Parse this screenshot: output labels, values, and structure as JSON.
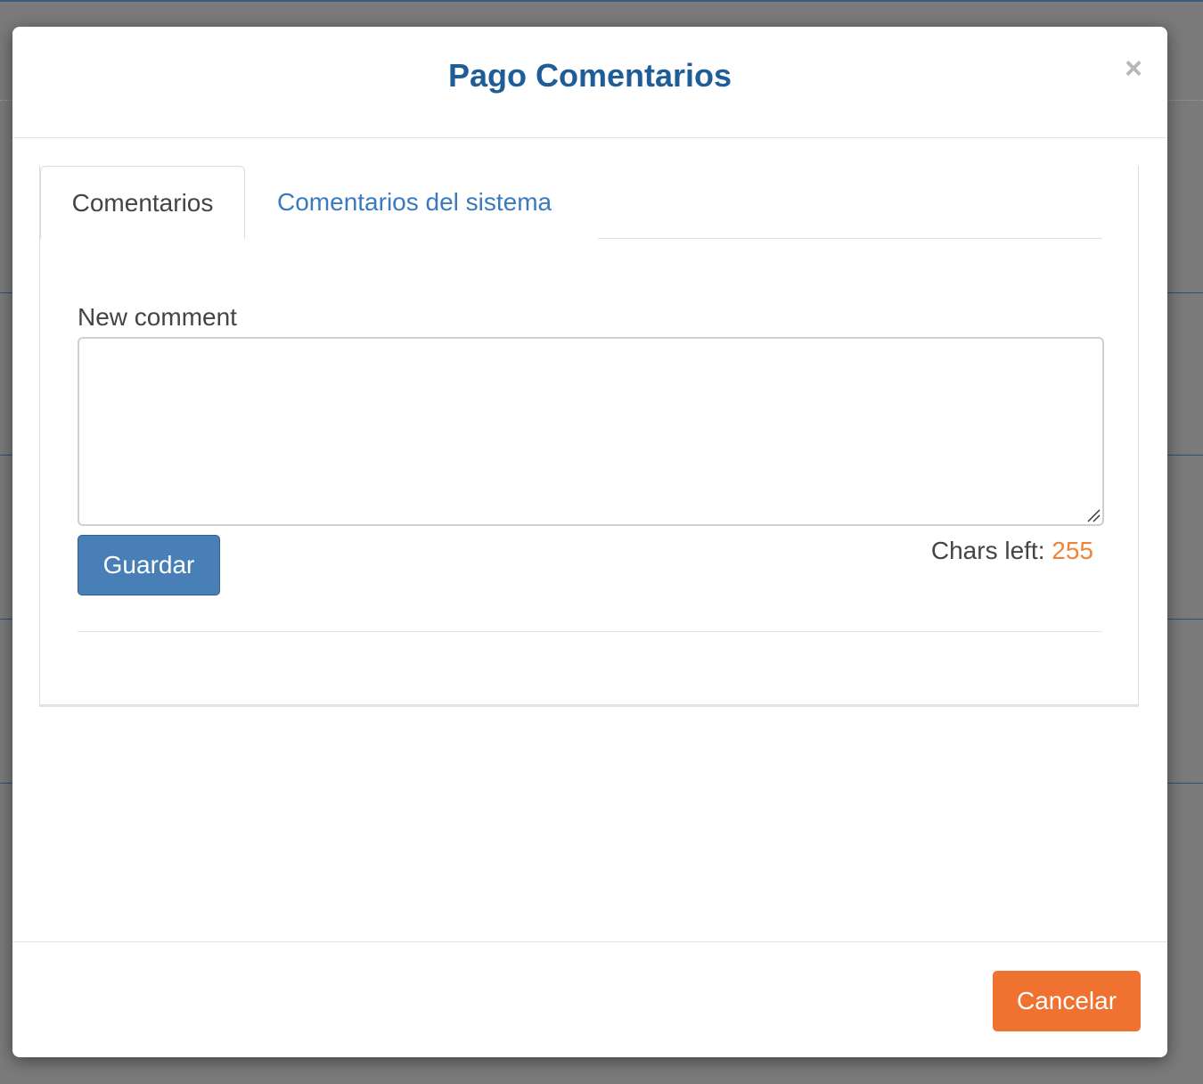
{
  "modal": {
    "title": "Pago Comentarios",
    "close_symbol": "×"
  },
  "tabs": [
    {
      "label": "Comentarios",
      "active": true
    },
    {
      "label": "Comentarios del sistema",
      "active": false
    }
  ],
  "comment_form": {
    "label": "New comment",
    "value": "",
    "save_label": "Guardar",
    "chars_left_label": "Chars left: ",
    "chars_left_value": "255"
  },
  "footer": {
    "cancel_label": "Cancelar"
  },
  "colors": {
    "title": "#1f5d96",
    "primary_button": "#487fb6",
    "cancel_button": "#f07230",
    "chars_left_count": "#f0833a",
    "tab_link": "#3a7abf"
  },
  "icons": {
    "close": "close-icon",
    "resize": "resize-grip-icon"
  }
}
